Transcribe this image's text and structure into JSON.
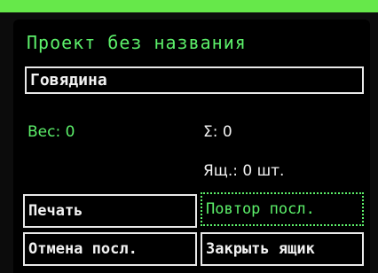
{
  "project": {
    "title": "Проект без названия",
    "product_value": "Говядина"
  },
  "stats": {
    "weight": "Вес: 0",
    "sum": "Σ: 0",
    "box_count": "Ящ.: 0 шт."
  },
  "buttons": {
    "print": "Печать",
    "repeat_last": "Повтор посл.",
    "undo_last": "Отмена посл.",
    "close_box": "Закрыть ящик"
  },
  "colors": {
    "accent": "#5cf06a",
    "top_bar": "#66e84a",
    "text": "#f2f2f2",
    "background": "#000000"
  }
}
